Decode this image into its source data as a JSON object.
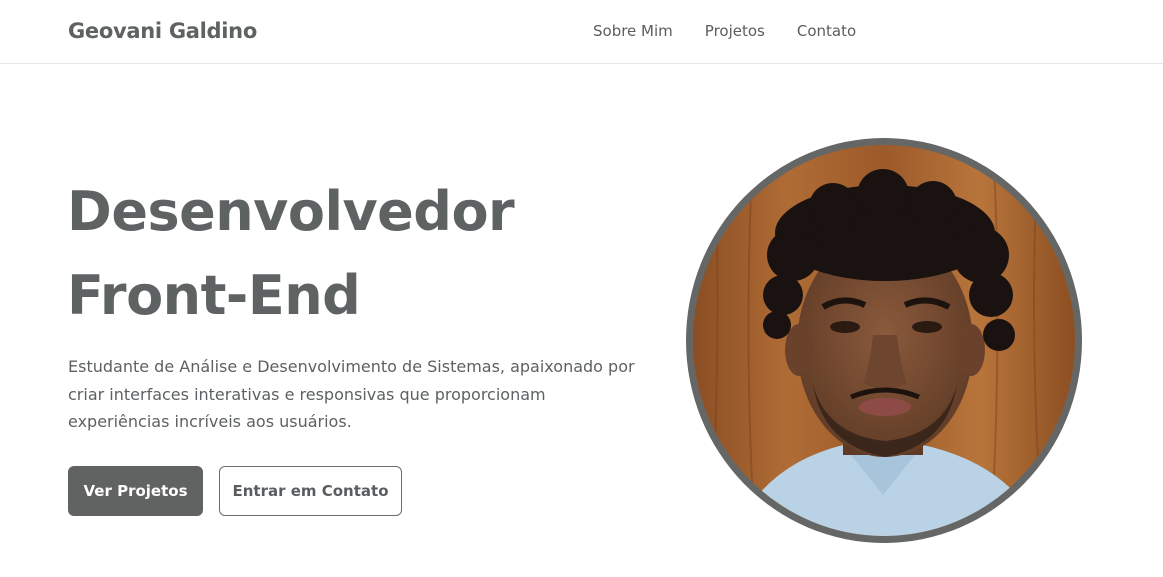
{
  "header": {
    "logo": "Geovani Galdino",
    "nav": [
      {
        "label": "Sobre Mim"
      },
      {
        "label": "Projetos"
      },
      {
        "label": "Contato"
      }
    ]
  },
  "hero": {
    "title_line1": "Desenvolvedor",
    "title_line2": "Front-End",
    "description": "Estudante de Análise e Desenvolvimento de Sistemas, apaixonado por criar interfaces interativas e responsivas que proporcionam experiências incríveis aos usuários.",
    "primary_button": "Ver Projetos",
    "secondary_button": "Entrar em Contato"
  },
  "colors": {
    "text": "#5f6263",
    "primary_button_bg": "#606362",
    "avatar_border": "#646766"
  }
}
